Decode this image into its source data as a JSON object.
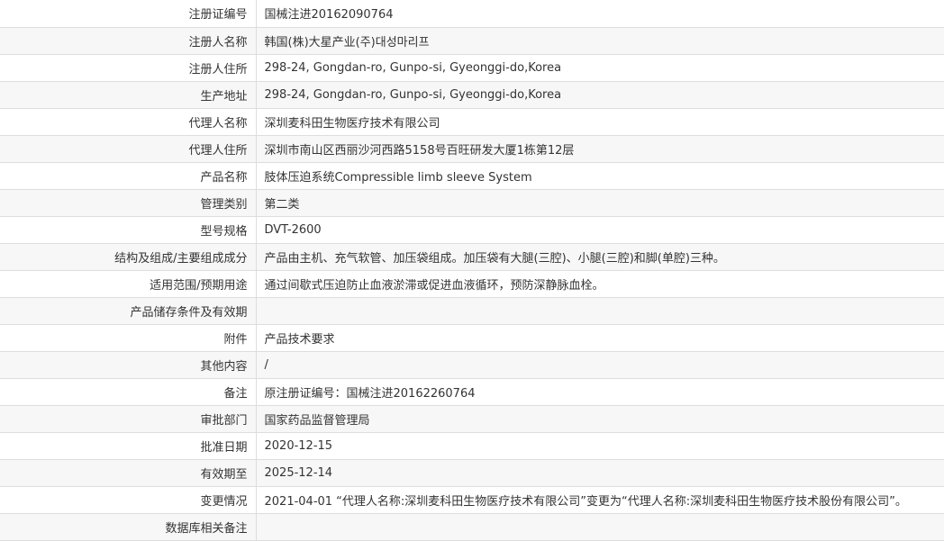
{
  "rows": [
    {
      "label": "注册证编号",
      "value": "国械注进20162090764"
    },
    {
      "label": "注册人名称",
      "value": "韩国(株)大星产业(주)대성마리프"
    },
    {
      "label": "注册人住所",
      "value": "298-24, Gongdan-ro, Gunpo-si, Gyeonggi-do,Korea"
    },
    {
      "label": "生产地址",
      "value": "298-24, Gongdan-ro, Gunpo-si, Gyeonggi-do,Korea"
    },
    {
      "label": "代理人名称",
      "value": "深圳麦科田生物医疗技术有限公司"
    },
    {
      "label": "代理人住所",
      "value": "深圳市南山区西丽沙河西路5158号百旺研发大厦1栋第12层"
    },
    {
      "label": "产品名称",
      "value": "肢体压迫系统Compressible limb sleeve System"
    },
    {
      "label": "管理类别",
      "value": "第二类"
    },
    {
      "label": "型号规格",
      "value": "DVT-2600"
    },
    {
      "label": "结构及组成/主要组成成分",
      "value": "产品由主机、充气软管、加压袋组成。加压袋有大腿(三腔)、小腿(三腔)和脚(单腔)三种。"
    },
    {
      "label": "适用范围/预期用途",
      "value": "通过间歇式压迫防止血液淤滞或促进血液循环，预防深静脉血栓。"
    },
    {
      "label": "产品储存条件及有效期",
      "value": ""
    },
    {
      "label": "附件",
      "value": "产品技术要求"
    },
    {
      "label": "其他内容",
      "value": "/"
    },
    {
      "label": "备注",
      "value": "原注册证编号：国械注进20162260764"
    },
    {
      "label": "审批部门",
      "value": "国家药品监督管理局"
    },
    {
      "label": "批准日期",
      "value": "2020-12-15"
    },
    {
      "label": "有效期至",
      "value": "2025-12-14"
    },
    {
      "label": "变更情况",
      "value": "2021-04-01 “代理人名称:深圳麦科田生物医疗技术有限公司”变更为“代理人名称:深圳麦科田生物医疗技术股份有限公司”。"
    },
    {
      "label": "数据库相关备注",
      "value": ""
    }
  ]
}
